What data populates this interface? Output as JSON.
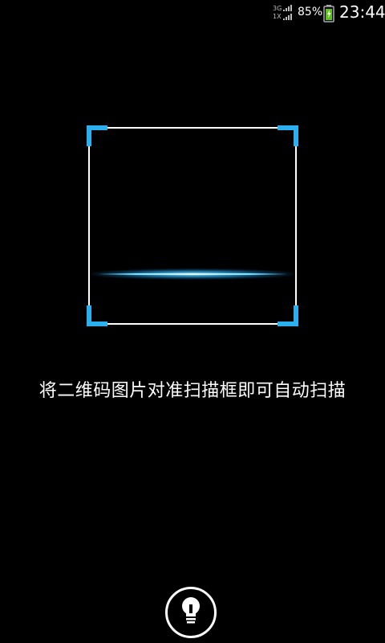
{
  "status_bar": {
    "network_top": "3G",
    "network_bottom": "1X",
    "battery_percent": "85%",
    "time": "23:44"
  },
  "scanner": {
    "hint": "将二维码图片对准扫描框即可自动扫描",
    "accent_color": "#2ab0ee"
  },
  "controls": {
    "flashlight_icon": "lightbulb-icon"
  }
}
